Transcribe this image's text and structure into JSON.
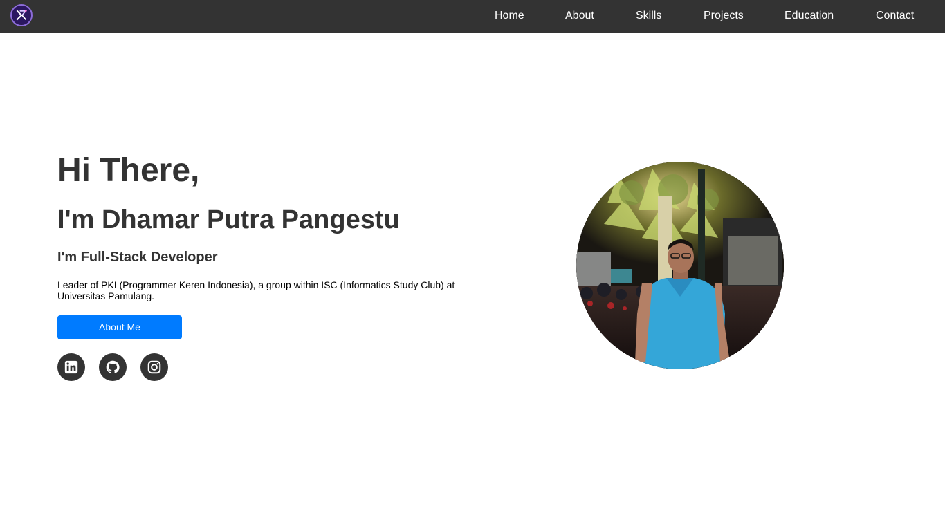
{
  "nav": {
    "items": [
      {
        "label": "Home"
      },
      {
        "label": "About"
      },
      {
        "label": "Skills"
      },
      {
        "label": "Projects"
      },
      {
        "label": "Education"
      },
      {
        "label": "Contact"
      }
    ]
  },
  "hero": {
    "greeting": "Hi There,",
    "name": "I'm Dhamar Putra Pangestu",
    "role": "I'm Full-Stack Developer",
    "description": "Leader of PKI (Programmer Keren Indonesia), a group within ISC (Informatics Study Club) at Universitas Pamulang.",
    "button_label": "About Me"
  },
  "social": [
    {
      "icon": "linkedin-icon"
    },
    {
      "icon": "github-icon"
    },
    {
      "icon": "instagram-icon"
    }
  ],
  "colors": {
    "navbar": "#333333",
    "primary_button": "#007bff",
    "text": "#333333"
  }
}
